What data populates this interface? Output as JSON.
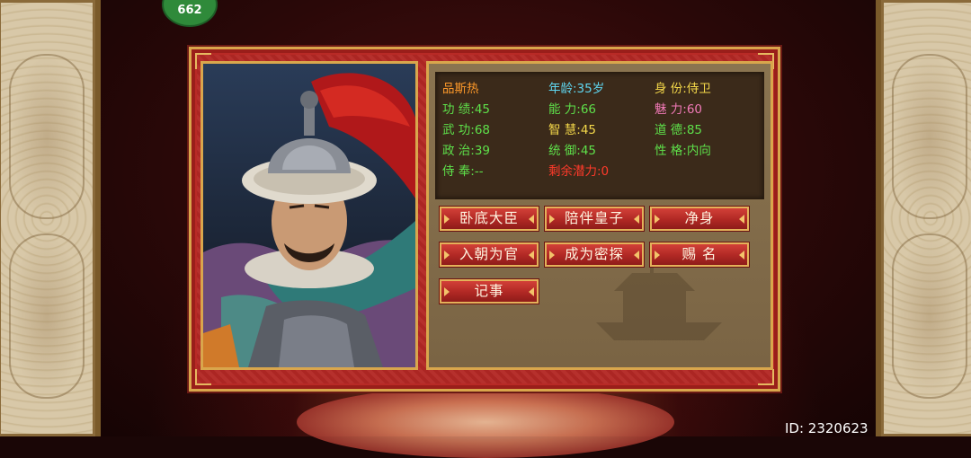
{
  "badge": {
    "text": "662"
  },
  "officer": {
    "name": "品斯热",
    "age": "年龄:35岁",
    "status": "身 份:侍卫",
    "merit": "功 绩:45",
    "ability": "能 力:66",
    "charm": "魅 力:60",
    "martial": "武 功:68",
    "wisdom": "智 慧:45",
    "morality": "道 德:85",
    "politics": "政 治:39",
    "command": "统 御:45",
    "personality": "性 格:内向",
    "salary": "侍 奉:--",
    "potential": "剩余潜力:0"
  },
  "actions": [
    {
      "label": "卧底大臣"
    },
    {
      "label": "陪伴皇子"
    },
    {
      "label": "净身"
    },
    {
      "label": "入朝为官"
    },
    {
      "label": "成为密探"
    },
    {
      "label": "赐 名"
    },
    {
      "label": "记事"
    }
  ],
  "footer": {
    "id_text": "ID: 2320623"
  },
  "colors": {
    "orange": "#ff9a2a",
    "cyan": "#5fd6f0",
    "yellow": "#f4d84a",
    "green": "#5ee04a",
    "pink": "#f27ab8",
    "red": "#ff3a2a",
    "frame_gold": "#d9a64c",
    "dialog_red": "#b82a26"
  }
}
